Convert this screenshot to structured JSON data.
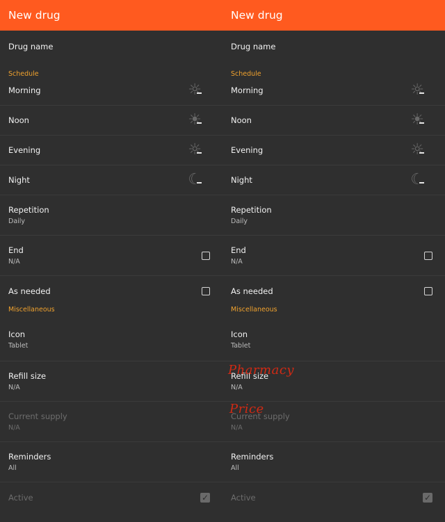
{
  "app_bar": {
    "title": "New drug"
  },
  "fields": {
    "drug_name": "Drug name",
    "schedule_header": "Schedule",
    "morning": "Morning",
    "noon": "Noon",
    "evening": "Evening",
    "night": "Night",
    "dose_placeholder": "–",
    "repetition": {
      "label": "Repetition",
      "value": "Daily"
    },
    "end": {
      "label": "End",
      "value": "N/A"
    },
    "as_needed": "As needed",
    "misc_header": "Miscellaneous",
    "icon": {
      "label": "Icon",
      "value": "Tablet"
    },
    "refill_size": {
      "label": "Refill size",
      "value": "N/A"
    },
    "current_supply": {
      "label": "Current supply",
      "value": "N/A"
    },
    "reminders": {
      "label": "Reminders",
      "value": "All"
    },
    "active": "Active"
  },
  "annotations": {
    "pharmacy": "Pharmacy",
    "price": "Price"
  },
  "icons": {
    "morning": "sunrise-icon",
    "noon": "sun-icon",
    "evening": "sunset-icon",
    "night": "moon-icon"
  },
  "colors": {
    "app_bar": "#ff5a1f",
    "section_header": "#f0a22e",
    "annotation": "#d12a14"
  }
}
